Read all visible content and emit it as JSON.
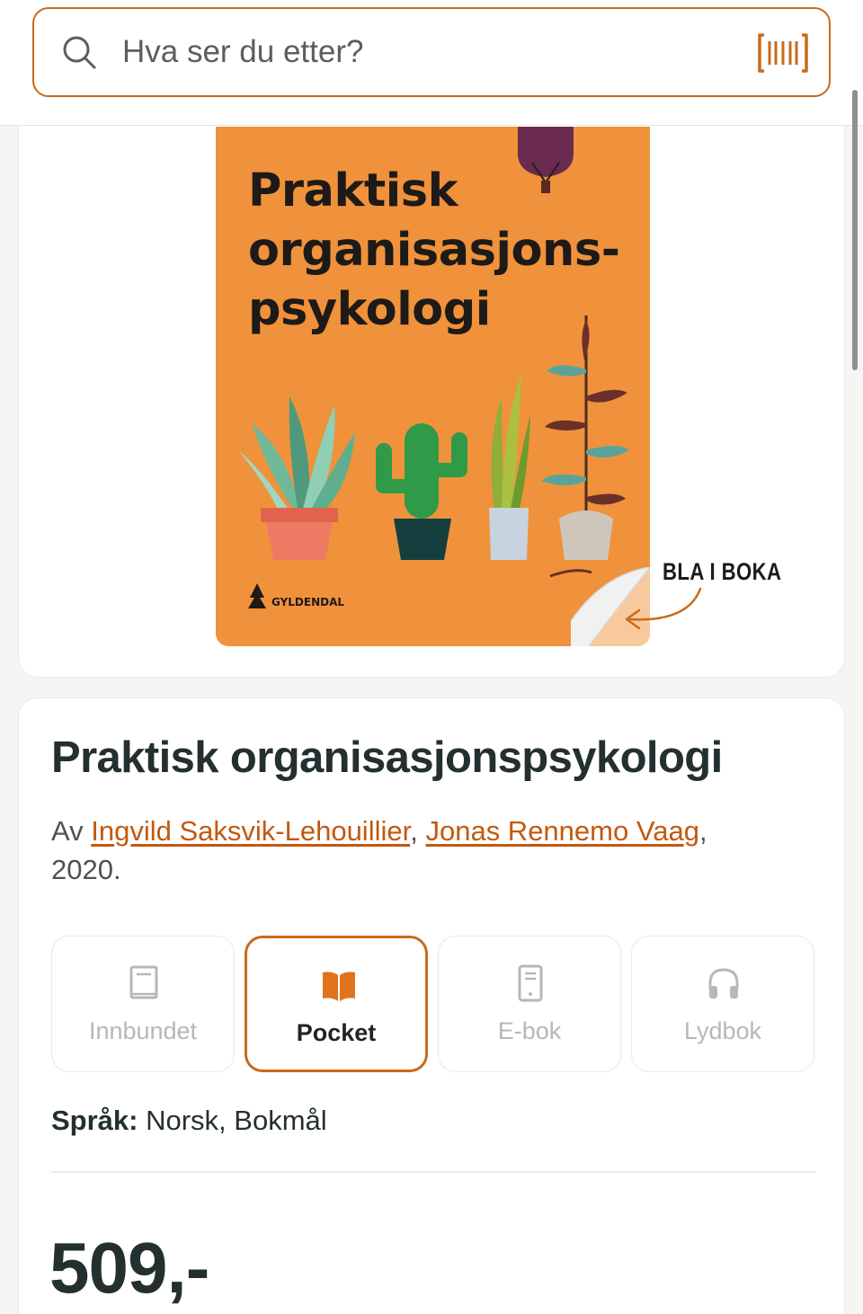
{
  "search": {
    "placeholder": "Hva ser du etter?",
    "icon": "search-icon",
    "scan_icon": "barcode-scan-icon"
  },
  "cover": {
    "title_lines": [
      "Praktisk",
      "organisasjons-",
      "psykologi"
    ],
    "publisher": "GYLDENDAL",
    "preview_label": "BLA I BOKA",
    "background_color": "#f0923b"
  },
  "product": {
    "title": "Praktisk organisasjonspsykologi",
    "by_prefix": "Av",
    "authors": [
      "Ingvild Saksvik-Lehouillier",
      "Jonas Rennemo Vaag"
    ],
    "separator": ",",
    "year": "2020."
  },
  "formats": [
    {
      "label": "Innbundet",
      "icon": "book-icon",
      "selected": false
    },
    {
      "label": "Pocket",
      "icon": "open-book-icon",
      "selected": true
    },
    {
      "label": "E-bok",
      "icon": "tablet-icon",
      "selected": false
    },
    {
      "label": "Lydbok",
      "icon": "headphones-icon",
      "selected": false
    }
  ],
  "language": {
    "label": "Språk:",
    "value": "Norsk, Bokmål"
  },
  "price": "509,-",
  "colors": {
    "accent": "#c96a1b",
    "link": "#c2590f",
    "text": "#23302f"
  }
}
